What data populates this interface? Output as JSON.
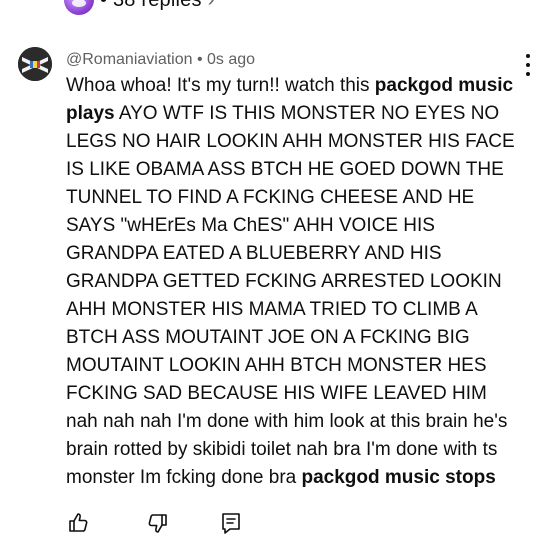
{
  "replies": {
    "text": "• 38 replies",
    "chevron": "›"
  },
  "comment": {
    "author": "@Romaniaviation",
    "separator": " • ",
    "time": "0s ago",
    "segments": [
      {
        "text": "Whoa whoa! It's my turn!! watch this ",
        "bold": false
      },
      {
        "text": "packgod music plays",
        "bold": true
      },
      {
        "text": " AYO WTF IS THIS MONSTER NO EYES NO LEGS NO HAIR LOOKIN AHH MONSTER HIS FACE IS LIKE OBAMA ASS BTCH HE GOED DOWN THE TUNNEL TO FIND A FCKING CHEESE AND HE SAYS \"wHErEs Ma ChES\" AHH VOICE HIS GRANDPA EATED A BLUEBERRY AND HIS GRANDPA GETTED FCKING ARRESTED LOOKIN AHH MONSTER HIS MAMA TRIED TO CLIMB A BTCH ASS MOUTAINT JOE ON A FCKING BIG MOUTAINT LOOKIN AHH BTCH MONSTER HES FCKING SAD BECAUSE HIS WIFE LEAVED HIM nah nah nah I'm done with him look at this brain he's brain rotted by skibidi toilet nah bra I'm done with ts monster Im fcking done bra ",
        "bold": false
      },
      {
        "text": "packgod music stops",
        "bold": true
      }
    ]
  },
  "icons": {
    "avatar": "flag-avatar-icon",
    "more": "more-vert-icon",
    "like": "thumb-up-icon",
    "dislike": "thumb-down-icon",
    "reply": "reply-comment-icon"
  },
  "colors": {
    "text": "#0f0f0f",
    "secondary": "#606060",
    "background": "#ffffff"
  }
}
